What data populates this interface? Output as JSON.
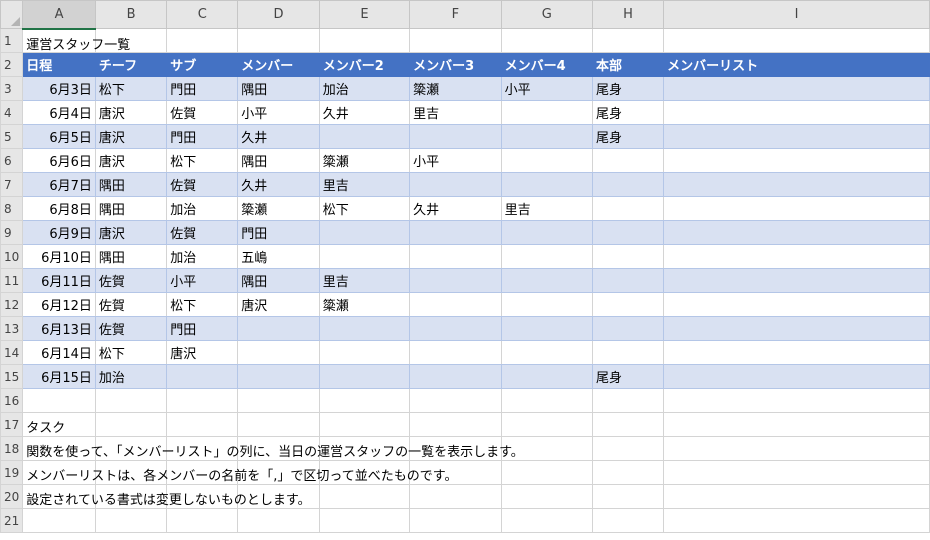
{
  "columns": [
    "A",
    "B",
    "C",
    "D",
    "E",
    "F",
    "G",
    "H",
    "I"
  ],
  "row_numbers": [
    "1",
    "2",
    "3",
    "4",
    "5",
    "6",
    "7",
    "8",
    "9",
    "10",
    "11",
    "12",
    "13",
    "14",
    "15",
    "16",
    "17",
    "18",
    "19",
    "20",
    "21"
  ],
  "title": "運営スタッフ一覧",
  "headers": [
    "日程",
    "チーフ",
    "サブ",
    "メンバー",
    "メンバー2",
    "メンバー3",
    "メンバー4",
    "本部",
    "メンバーリスト"
  ],
  "rows": [
    [
      "6月3日",
      "松下",
      "門田",
      "隅田",
      "加治",
      "簗瀬",
      "小平",
      "尾身",
      ""
    ],
    [
      "6月4日",
      "唐沢",
      "佐賀",
      "小平",
      "久井",
      "里吉",
      "",
      "尾身",
      ""
    ],
    [
      "6月5日",
      "唐沢",
      "門田",
      "久井",
      "",
      "",
      "",
      "尾身",
      ""
    ],
    [
      "6月6日",
      "唐沢",
      "松下",
      "隅田",
      "簗瀬",
      "小平",
      "",
      "",
      ""
    ],
    [
      "6月7日",
      "隅田",
      "佐賀",
      "久井",
      "里吉",
      "",
      "",
      "",
      ""
    ],
    [
      "6月8日",
      "隅田",
      "加治",
      "簗瀬",
      "松下",
      "久井",
      "里吉",
      "",
      ""
    ],
    [
      "6月9日",
      "唐沢",
      "佐賀",
      "門田",
      "",
      "",
      "",
      "",
      ""
    ],
    [
      "6月10日",
      "隅田",
      "加治",
      "五嶋",
      "",
      "",
      "",
      "",
      ""
    ],
    [
      "6月11日",
      "佐賀",
      "小平",
      "隅田",
      "里吉",
      "",
      "",
      "",
      ""
    ],
    [
      "6月12日",
      "佐賀",
      "松下",
      "唐沢",
      "簗瀬",
      "",
      "",
      "",
      ""
    ],
    [
      "6月13日",
      "佐賀",
      "門田",
      "",
      "",
      "",
      "",
      "",
      ""
    ],
    [
      "6月14日",
      "松下",
      "唐沢",
      "",
      "",
      "",
      "",
      "",
      ""
    ],
    [
      "6月15日",
      "加治",
      "",
      "",
      "",
      "",
      "",
      "尾身",
      ""
    ]
  ],
  "notes": {
    "task_label": "タスク",
    "line1": "関数を使って、「メンバーリスト」の列に、当日の運営スタッフの一覧を表示します。",
    "line2": "メンバーリストは、各メンバーの名前を「,」で区切って並べたものです。",
    "line3": "設定されている書式は変更しないものとします。"
  }
}
